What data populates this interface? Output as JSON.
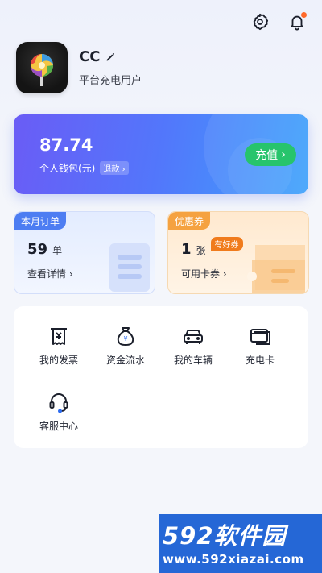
{
  "header": {
    "settings_icon": "gear-icon",
    "notifications_icon": "bell-icon"
  },
  "profile": {
    "username": "CC",
    "subtitle": "平台充电用户"
  },
  "wallet": {
    "balance": "87.74",
    "label": "个人钱包(元)",
    "refund_label": "退款",
    "topup_label": "充值"
  },
  "orders_card": {
    "tag": "本月订单",
    "count": "59",
    "unit": "单",
    "link": "查看详情"
  },
  "coupons_card": {
    "tag": "优惠券",
    "count": "1",
    "unit": "张",
    "badge": "有好券",
    "link": "可用卡券"
  },
  "services": [
    {
      "label": "我的发票",
      "icon": "invoice-icon"
    },
    {
      "label": "资金流水",
      "icon": "money-bag-icon"
    },
    {
      "label": "我的车辆",
      "icon": "car-icon"
    },
    {
      "label": "充电卡",
      "icon": "card-icon"
    },
    {
      "label": "客服中心",
      "icon": "headset-icon"
    }
  ],
  "watermark": {
    "title": "592软件园",
    "url": "www.592xiazai.com"
  },
  "colors": {
    "wallet_start": "#6a5cf6",
    "wallet_end": "#3fa3fb",
    "topup": "#27c46c",
    "orders_tag": "#4d7df2",
    "coupon_tag": "#f5a240"
  }
}
